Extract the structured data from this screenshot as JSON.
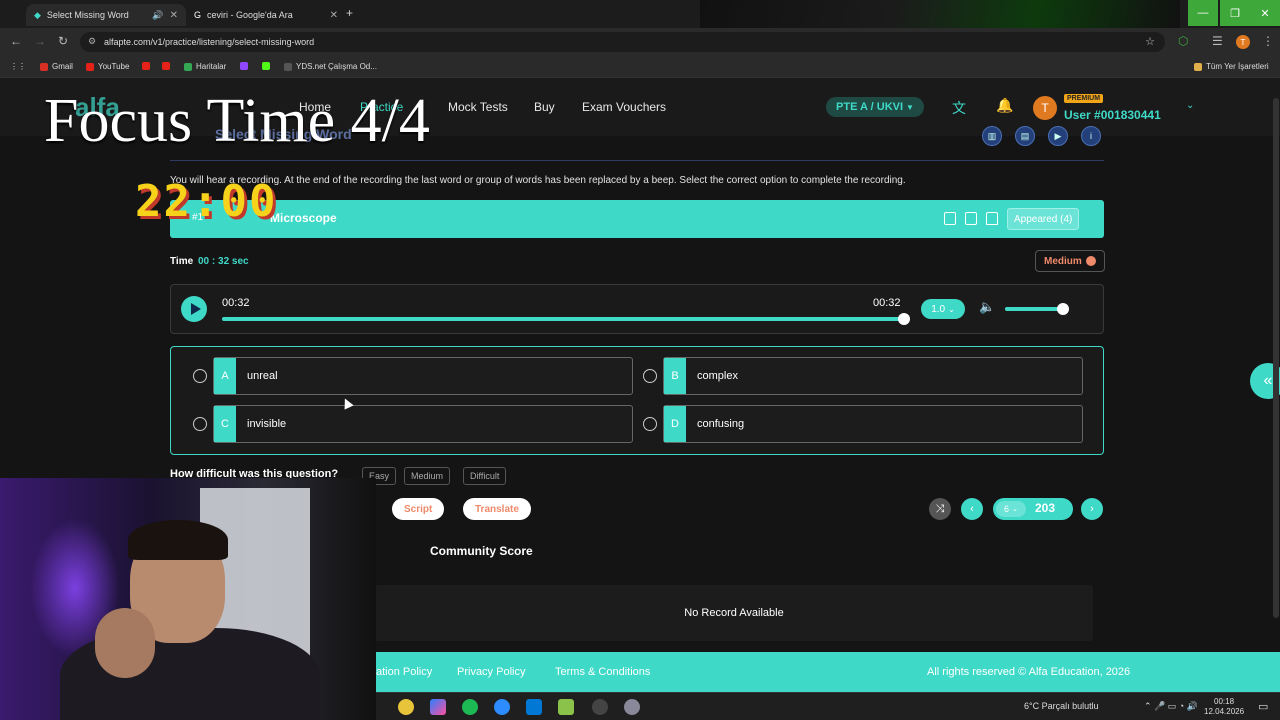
{
  "browser": {
    "tabs": [
      {
        "title": "Select Missing Word",
        "active": true
      },
      {
        "title": "ceviri - Google'da Ara",
        "active": false
      }
    ],
    "url": "alfapte.com/v1/practice/listening/select-missing-word",
    "bookmarks": [
      "Gmail",
      "YouTube",
      "Haritalar",
      "YDS.net Çalışma Od..."
    ],
    "all_bookmarks": "Tüm Yer İşaretleri"
  },
  "site": {
    "logo": "alfa",
    "nav": [
      "Home",
      "Practice",
      "Mock Tests",
      "Buy",
      "Exam Vouchers"
    ],
    "exam_selector": "PTE A / UKVI",
    "avatar_initial": "T",
    "premium_badge": "PREMIUM",
    "user": "User #001830441"
  },
  "overlays": {
    "focus": "Focus Time 4/4",
    "timer": "22:00"
  },
  "question": {
    "heading": "Select Missing Word",
    "instructions": "You will hear a recording. At the end of the recording the last word or group of words has been replaced by a beep. Select the correct option to complete the recording.",
    "number": "#1",
    "title": "Microscope",
    "appeared": "Appeared (4)",
    "time_label": "Time",
    "time_value": "00 : 32 sec",
    "difficulty": "Medium"
  },
  "player": {
    "current": "00:32",
    "duration": "00:32",
    "progress": 1.0,
    "speed": "1.0",
    "volume": 0.9
  },
  "options": [
    {
      "letter": "A",
      "text": "unreal"
    },
    {
      "letter": "B",
      "text": "complex"
    },
    {
      "letter": "C",
      "text": "invisible"
    },
    {
      "letter": "D",
      "text": "confusing"
    }
  ],
  "feedback": {
    "question": "How difficult was this question?",
    "choices": [
      "Easy",
      "Medium",
      "Difficult"
    ]
  },
  "actions": {
    "script": "Script",
    "translate": "Translate",
    "page": "6",
    "total": "203"
  },
  "community": {
    "title": "Community Score",
    "empty": "No Record Available"
  },
  "footer": {
    "links": [
      "ation Policy",
      "Privacy Policy",
      "Terms & Conditions"
    ],
    "copyright": "All rights reserved © Alfa Education, 2026"
  },
  "taskbar": {
    "weather": "6°C  Parçalı bulutlu",
    "time": "00:18",
    "date": "12.04.2026"
  },
  "colors": {
    "accent": "#3fd9c8",
    "warning": "#ef8a6a",
    "premium": "#f2a617"
  }
}
